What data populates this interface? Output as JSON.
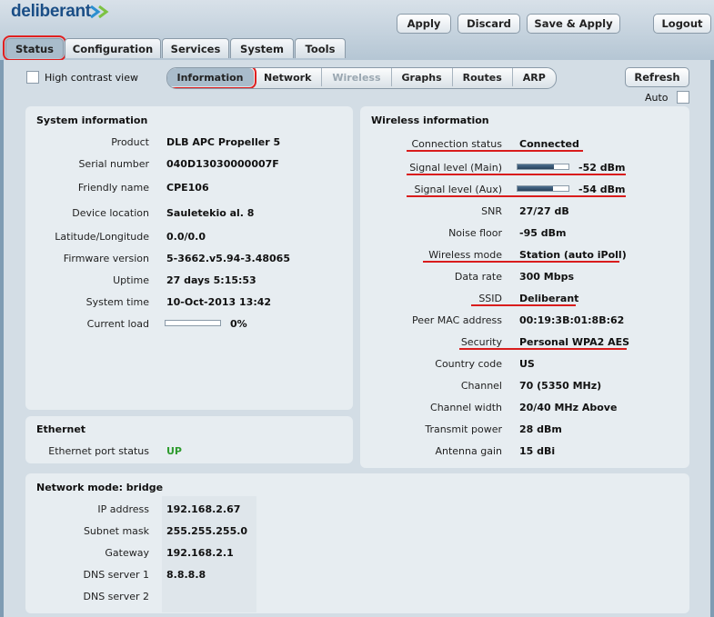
{
  "brand": {
    "name": "deliberant"
  },
  "header": {
    "apply": "Apply",
    "discard": "Discard",
    "save_apply": "Save & Apply",
    "logout": "Logout"
  },
  "main_tabs": [
    "Status",
    "Configuration",
    "Services",
    "System",
    "Tools"
  ],
  "high_contrast": {
    "label": "High contrast view"
  },
  "sub_tabs": [
    "Information",
    "Network",
    "Wireless",
    "Graphs",
    "Routes",
    "ARP"
  ],
  "refresh": {
    "label": "Refresh",
    "auto_label": "Auto"
  },
  "system": {
    "title": "System information",
    "rows": [
      {
        "label": "Product",
        "value": "DLB APC Propeller 5"
      },
      {
        "label": "Serial number",
        "value": "040D13030000007F"
      },
      {
        "label": "Friendly name",
        "value": "CPE106"
      },
      {
        "label": "Device location",
        "value": "Sauletekio al. 8"
      },
      {
        "label": "Latitude/Longitude",
        "value": "0.0/0.0"
      },
      {
        "label": "Firmware version",
        "value": "5-3662.v5.94-3.48065"
      },
      {
        "label": "Uptime",
        "value": "27 days 5:15:53"
      },
      {
        "label": "System time",
        "value": "10-Oct-2013 13:42"
      }
    ],
    "load": {
      "label": "Current load",
      "value": "0%",
      "fraction": 0.0
    }
  },
  "ethernet": {
    "title": "Ethernet",
    "port_label": "Ethernet port status",
    "port_value": "UP"
  },
  "wireless": {
    "title": "Wireless information",
    "connection": {
      "label": "Connection status",
      "value": "Connected"
    },
    "signal_main": {
      "label": "Signal level (Main)",
      "value": "-52 dBm",
      "fraction": 0.72
    },
    "signal_aux": {
      "label": "Signal level (Aux)",
      "value": "-54 dBm",
      "fraction": 0.7
    },
    "rows": [
      {
        "label": "SNR",
        "value": "27/27 dB"
      },
      {
        "label": "Noise floor",
        "value": "-95 dBm"
      },
      {
        "label": "Wireless mode",
        "value": "Station (auto iPoll)"
      },
      {
        "label": "Data rate",
        "value": "300 Mbps"
      },
      {
        "label": "SSID",
        "value": "Deliberant"
      },
      {
        "label": "Peer MAC address",
        "value": "00:19:3B:01:8B:62"
      },
      {
        "label": "Security",
        "value": "Personal WPA2 AES"
      },
      {
        "label": "Country code",
        "value": "US"
      },
      {
        "label": "Channel",
        "value": "70 (5350 MHz)"
      },
      {
        "label": "Channel width",
        "value": "20/40 MHz Above"
      },
      {
        "label": "Transmit power",
        "value": "28 dBm"
      },
      {
        "label": "Antenna gain",
        "value": "15 dBi"
      }
    ]
  },
  "network": {
    "title": "Network mode: bridge",
    "rows": [
      {
        "label": "IP address",
        "value": "192.168.2.67"
      },
      {
        "label": "Subnet mask",
        "value": "255.255.255.0"
      },
      {
        "label": "Gateway",
        "value": "192.168.2.1"
      },
      {
        "label": "DNS server 1",
        "value": "8.8.8.8"
      },
      {
        "label": "DNS server 2",
        "value": ""
      }
    ]
  },
  "colors": {
    "accent_red": "#d91c1c",
    "status_up": "#2e9b2e",
    "brand_blue": "#1a4e86"
  }
}
